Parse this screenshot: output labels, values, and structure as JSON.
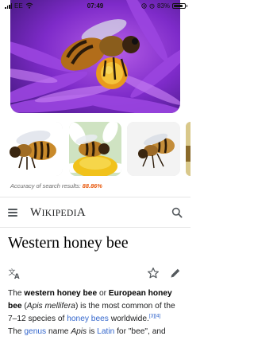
{
  "status_bar": {
    "carrier": "EE",
    "time": "07:49",
    "battery_text": "83%",
    "battery_level": 0.83,
    "icons": [
      "signal-icon",
      "wifi-icon",
      "location-icon",
      "alarm-icon",
      "battery-icon"
    ]
  },
  "visual_search": {
    "hero_image": "bee-on-purple-aster-photo",
    "thumbnails": [
      "bee-photo",
      "bee-on-yellow-flower-photo",
      "bee-on-grey-photo",
      "partial-bee-photo"
    ],
    "accuracy_label": "Accuracy of search results:",
    "accuracy_value": "88.86%",
    "accent_color": "#e8580c"
  },
  "wikipedia": {
    "wordmark_first": "W",
    "wordmark_rest": "IKIPEDI",
    "wordmark_last": "A",
    "icons": [
      "menu-icon",
      "search-icon",
      "translate-icon",
      "star-icon",
      "edit-icon"
    ],
    "article_title": "Western honey bee",
    "paragraph": {
      "t1": "The ",
      "b1": "western honey bee",
      "t2": " or ",
      "b2": "European honey bee",
      "t3": " (",
      "i1": "Apis mellifera",
      "t4": ") is the most common of the 7–12 species of ",
      "link1": "honey bees",
      "t5": " worldwide.",
      "ref": "[3][4]",
      "t6": "The ",
      "link2": "genus",
      "t7": " name ",
      "i2": "Apis",
      "t8": " is ",
      "link3": "Latin",
      "t9": " for \"bee\", and"
    },
    "link_color": "#3366cc"
  }
}
